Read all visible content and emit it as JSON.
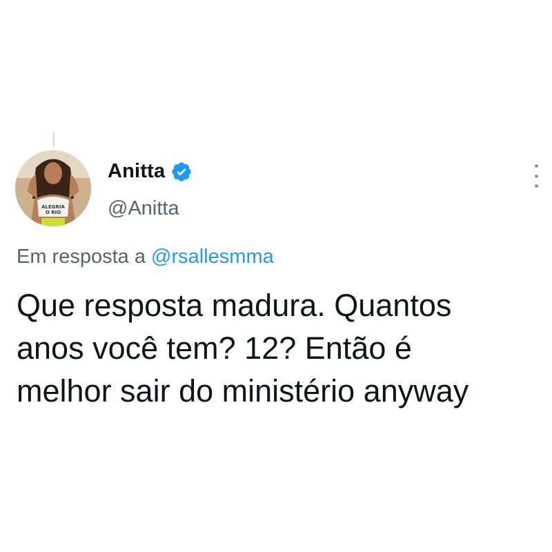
{
  "tweet": {
    "author": {
      "display_name": "Anitta",
      "handle": "@Anitta",
      "verified": true,
      "verified_color": "#1d9bf0",
      "avatar_shirt_text": "ALEGRIA O RIO"
    },
    "reply_to": {
      "prefix": "Em resposta a",
      "mention": "@rsallesmma"
    },
    "text_lines": [
      "Que resposta madura. Quantos",
      "anos você tem? 12? Então é",
      "melhor sair do ministério anyway"
    ]
  },
  "icons": {
    "verified": "verified-badge-icon",
    "more": "more-options-icon"
  },
  "colors": {
    "text_primary": "#0f1419",
    "text_secondary": "#536471",
    "link": "#1d9bf0",
    "background": "#ffffff"
  }
}
